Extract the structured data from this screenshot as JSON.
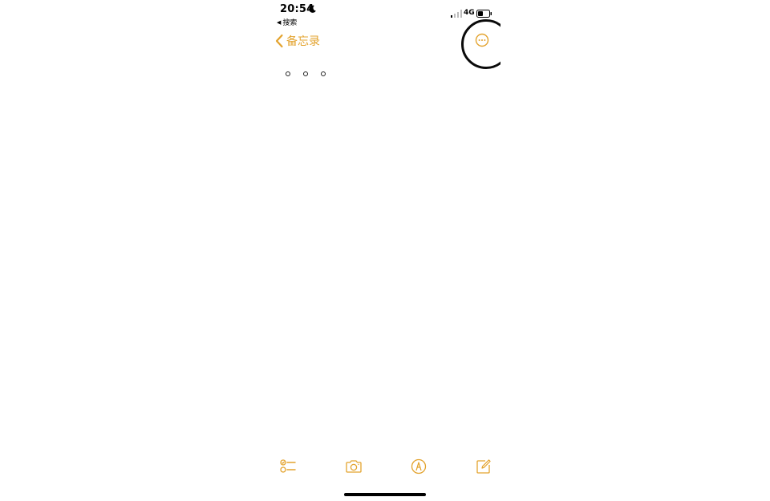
{
  "status_bar": {
    "time": "20:54",
    "back_app_label": "搜索",
    "network": "4G"
  },
  "nav": {
    "back_label": "备忘录"
  },
  "icons": {
    "moon": "moon-icon",
    "signal": "signal-icon",
    "battery": "battery-icon",
    "back": "chevron-left-icon",
    "more": "ellipsis-circle-icon",
    "checklist": "checklist-icon",
    "camera": "camera-icon",
    "markup": "pen-tip-icon",
    "compose": "compose-icon"
  },
  "colors": {
    "accent": "#e3a32e",
    "background": "#ffffff"
  }
}
